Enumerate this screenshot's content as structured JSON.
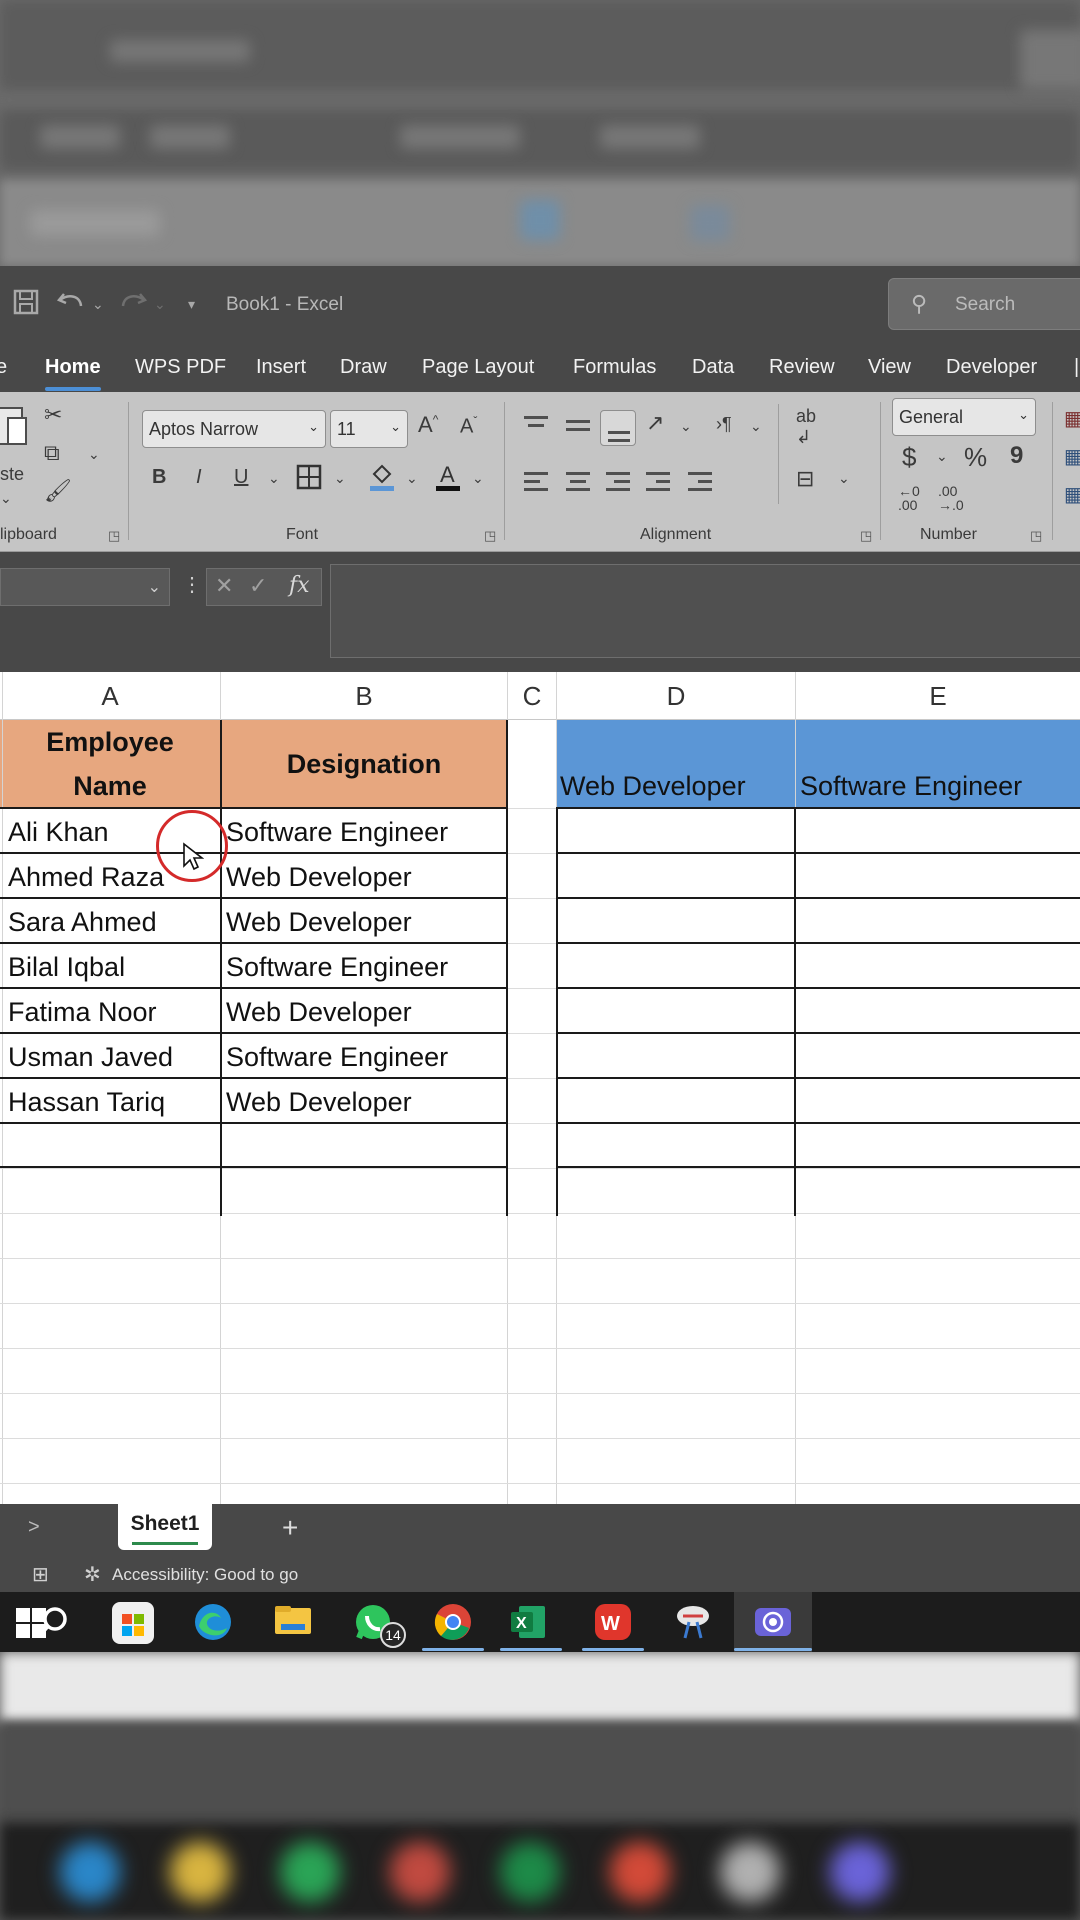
{
  "window": {
    "title": "Book1  -  Excel",
    "search_placeholder": "Search"
  },
  "tabs": [
    "e",
    "Home",
    "WPS PDF",
    "Insert",
    "Draw",
    "Page Layout",
    "Formulas",
    "Data",
    "Review",
    "View",
    "Developer"
  ],
  "ribbon": {
    "clipboard": {
      "label": "lipboard",
      "paste_label": "ste"
    },
    "font": {
      "label": "Font",
      "font_name": "Aptos Narrow",
      "font_size": "11",
      "bold": "B",
      "italic": "I",
      "underline": "U"
    },
    "alignment": {
      "label": "Alignment"
    },
    "number": {
      "label": "Number",
      "format": "General",
      "currency": "$",
      "percent": "%",
      "comma": "9"
    }
  },
  "formula_bar": {
    "fx": "fx"
  },
  "columns": [
    "A",
    "B",
    "C",
    "D",
    "E"
  ],
  "headers": {
    "a": "Employee Name",
    "b": "Designation",
    "d": "Web Developer",
    "e": "Software Engineer"
  },
  "rows": [
    {
      "name": "Ali Khan",
      "designation": "Software Engineer"
    },
    {
      "name": "Ahmed Raza",
      "designation": "Web Developer"
    },
    {
      "name": "Sara Ahmed",
      "designation": "Web Developer"
    },
    {
      "name": "Bilal Iqbal",
      "designation": "Software Engineer"
    },
    {
      "name": "Fatima Noor",
      "designation": "Web Developer"
    },
    {
      "name": "Usman Javed",
      "designation": "Software Engineer"
    },
    {
      "name": "Hassan Tariq",
      "designation": "Web Developer"
    }
  ],
  "sheets": {
    "active": "Sheet1",
    "add": "+",
    "nav": ">"
  },
  "status": {
    "accessibility": "Accessibility: Good to go"
  },
  "taskbar": {
    "whatsapp_badge": "14"
  },
  "colors": {
    "orange_header": "#e7a77f",
    "blue_header": "#5b96d6",
    "excel_green": "#1d7a43"
  }
}
